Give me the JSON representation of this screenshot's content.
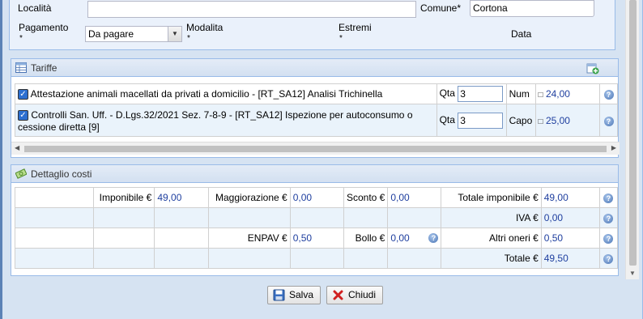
{
  "form": {
    "localita_label": "Località",
    "localita_value": "",
    "comune_label": "Comune*",
    "comune_value": "Cortona",
    "pagamento_label": "Pagamento",
    "pagamento_req": "*",
    "pagamento_value": "Da pagare",
    "modalita_label": "Modalita",
    "modalita_req": "*",
    "estremi_label": "Estremi",
    "estremi_req": "*",
    "data_label": "Data"
  },
  "tariffe": {
    "title": "Tariffe",
    "rows": [
      {
        "checked": true,
        "description": "Attestazione animali macellati da privati a domicilio - [RT_SA12] Analisi Trichinella",
        "qta_label": "Qta",
        "qta": "3",
        "unit": "Num",
        "price_icon": "□",
        "price": "24,00"
      },
      {
        "checked": true,
        "description_line1": "Controlli San. Uff. - D.Lgs.32/2021 Sez. 7-8-9 - [RT_SA12] Ispezione per autoconsumo o",
        "description_line2": "cessione diretta [9]",
        "qta_label": "Qta",
        "qta": "3",
        "unit": "Capo",
        "price_icon": "□",
        "price": "25,00"
      }
    ]
  },
  "dettaglio": {
    "title": "Dettaglio costi",
    "imponibile_label": "Imponibile €",
    "imponibile": "49,00",
    "maggiorazione_label": "Maggiorazione €",
    "maggiorazione": "0,00",
    "sconto_label": "Sconto €",
    "sconto": "0,00",
    "totale_imponibile_label": "Totale imponibile €",
    "totale_imponibile": "49,00",
    "iva_label": "IVA €",
    "iva": "0,00",
    "enpav_label": "ENPAV €",
    "enpav": "0,50",
    "bollo_label": "Bollo €",
    "bollo": "0,00",
    "altri_oneri_label": "Altri oneri €",
    "altri_oneri": "0,50",
    "totale_label": "Totale €",
    "totale": "49,50"
  },
  "buttons": {
    "salva": "Salva",
    "chiudi": "Chiudi"
  },
  "colors": {
    "value_blue": "#1f3f9f",
    "panel_border": "#99bbe8",
    "close_red": "#d02020"
  }
}
